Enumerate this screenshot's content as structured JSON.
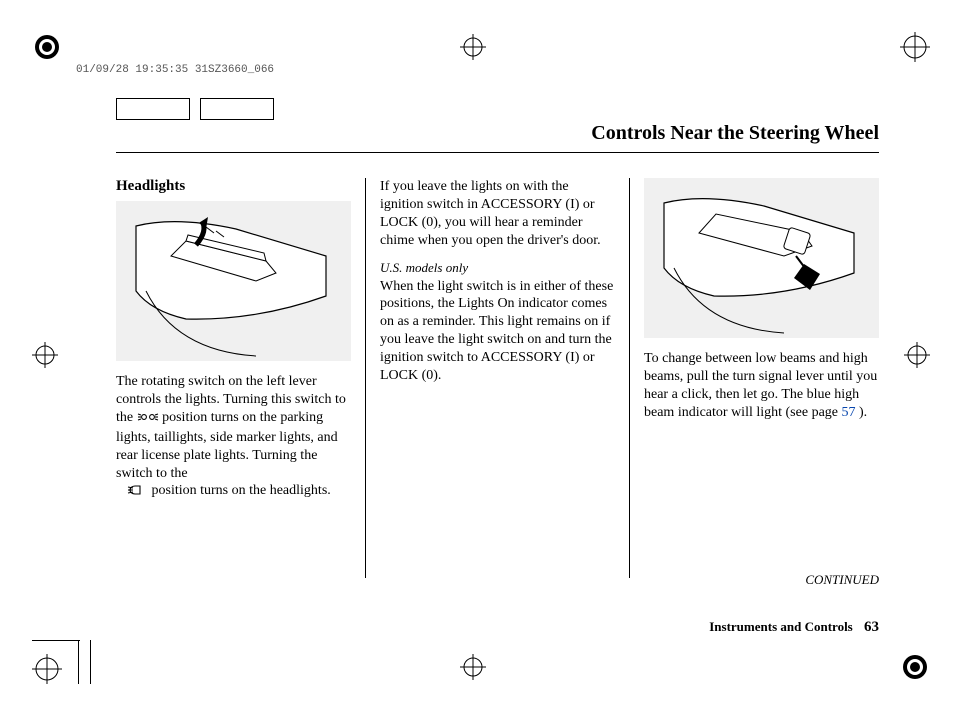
{
  "stamp": "01/09/28 19:35:35 31SZ3660_066",
  "title": "Controls Near the Steering Wheel",
  "col1": {
    "heading": "Headlights",
    "p1a": "The rotating switch on the left lever controls the lights. Turning this switch to the ",
    "p1b": " position turns on the parking lights, taillights, side marker lights, and rear license plate lights. Turning the switch to the ",
    "p1c": " position turns on the headlights."
  },
  "col2": {
    "p1": "If you leave the lights on with the ignition switch in ACCESSORY (I) or LOCK (0), you will hear a reminder chime when you open the driver's door.",
    "sub": "U.S. models only",
    "p2": "When the light switch is in either of these positions, the Lights On indicator comes on as a reminder. This light remains on if you leave the light switch on and turn the ignition switch to ACCESSORY (I) or LOCK (0)."
  },
  "col3": {
    "p1a": "To change between low beams and high beams, pull the turn signal lever until you hear a click, then let go. The blue high beam indicator will light (see page ",
    "link": "57",
    "p1b": " )."
  },
  "continued": "CONTINUED",
  "footer_section": "Instruments and Controls",
  "page_no": "63"
}
